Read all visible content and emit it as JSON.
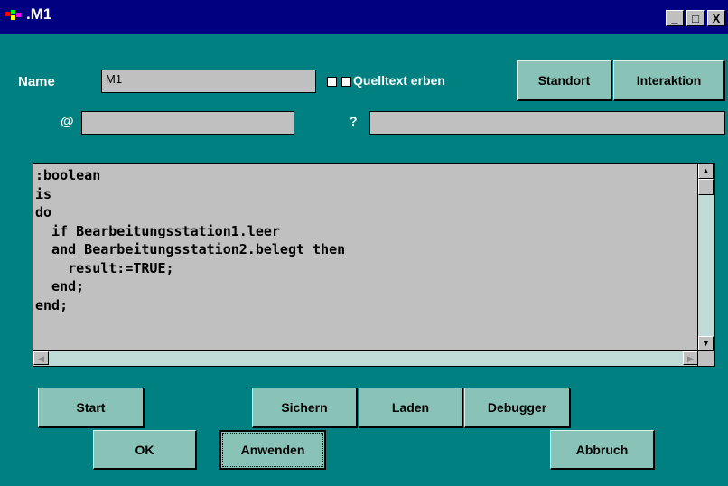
{
  "window": {
    "title": ".M1",
    "minimize_label": "_",
    "maximize_label": "□",
    "close_label": "X"
  },
  "form": {
    "name_label": "Name",
    "name_value": "M1",
    "inherit_label": "Quelltext erben",
    "at_label": "@",
    "at_value": "",
    "question_label": "?",
    "question_value": ""
  },
  "buttons": {
    "standort": "Standort",
    "interaktion": "Interaktion",
    "start": "Start",
    "sichern": "Sichern",
    "laden": "Laden",
    "debugger": "Debugger",
    "ok": "OK",
    "anwenden": "Anwenden",
    "abbruch": "Abbruch"
  },
  "editor": {
    "code": ":boolean\nis\ndo\n  if Bearbeitungsstation1.leer\n  and Bearbeitungsstation2.belegt then\n    result:=TRUE;\n  end;\nend;"
  },
  "colors": {
    "window_bg": "#008080",
    "titlebar_bg": "#000080",
    "button_bg": "#89c2b6",
    "field_bg": "#c0c0c0"
  }
}
